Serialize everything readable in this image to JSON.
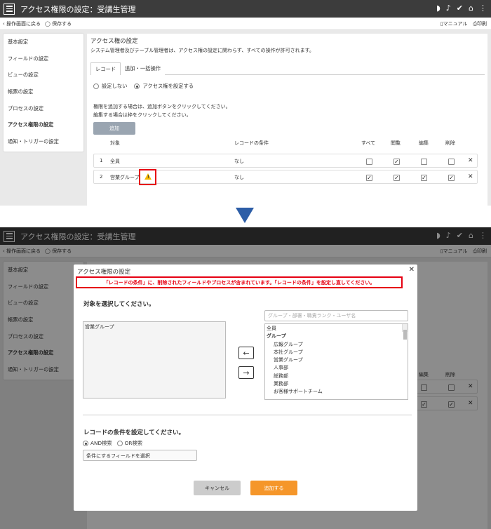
{
  "app": {
    "title": "アクセス権限の設定：受講生管理",
    "back_label": "操作画面に戻る",
    "save_label": "保存する",
    "manual_label": "マニュアル",
    "print_label": "印刷"
  },
  "sidebar": {
    "items": [
      {
        "label": "基本設定"
      },
      {
        "label": "フィールドの設定"
      },
      {
        "label": "ビューの設定"
      },
      {
        "label": "帳票の設定"
      },
      {
        "label": "プロセスの設定"
      },
      {
        "label": "アクセス権限の設定"
      },
      {
        "label": "通知・トリガーの設定"
      }
    ]
  },
  "main": {
    "title": "アクセス権の設定",
    "desc": "システム管理者及びテーブル管理者は、アクセス権の設定に関わらず、すべての操作が許可されます。",
    "tabs": [
      {
        "label": "レコード"
      },
      {
        "label": "追加・一括操作"
      }
    ],
    "radio_off": "設定しない",
    "radio_on": "アクセス権を設定する",
    "instr1": "権限を追加する場合は、追加ボタンをクリックしてください。",
    "instr2": "編集する場合は枠をクリックしてください。",
    "add_label": "追加",
    "columns": {
      "target": "対象",
      "condition": "レコードの条件",
      "all": "すべて",
      "view": "閲覧",
      "edit": "編集",
      "delete": "削除"
    },
    "rows": [
      {
        "no": "1",
        "target": "全員",
        "condition": "なし",
        "checks": [
          false,
          true,
          false,
          false
        ]
      },
      {
        "no": "2",
        "target": "営業グループ",
        "condition": "なし",
        "checks": [
          true,
          true,
          true,
          true
        ]
      }
    ]
  },
  "warning_icon": "warning-icon",
  "modal": {
    "title": "アクセス権限の設定",
    "error": "「レコードの条件」に、削除されたフィールドやプロセスが含まれています。「レコードの条件」を設定し直してください。",
    "select_heading": "対象を選択してください。",
    "selected": [
      "営業グループ"
    ],
    "search_placeholder": "グループ・部署・職責ランク・ユーザ名",
    "options": [
      "全員",
      "グループ",
      "広報グループ",
      "本社グループ",
      "営業グループ",
      "人事部",
      "総務部",
      "業務部",
      "お客様サポートチーム"
    ],
    "cond_heading": "レコードの条件を設定してください。",
    "and_label": "AND検索",
    "or_label": "OR検索",
    "cond_placeholder": "条件にするフィールドを選択",
    "cancel_label": "キャンセル",
    "submit_label": "追加する"
  }
}
